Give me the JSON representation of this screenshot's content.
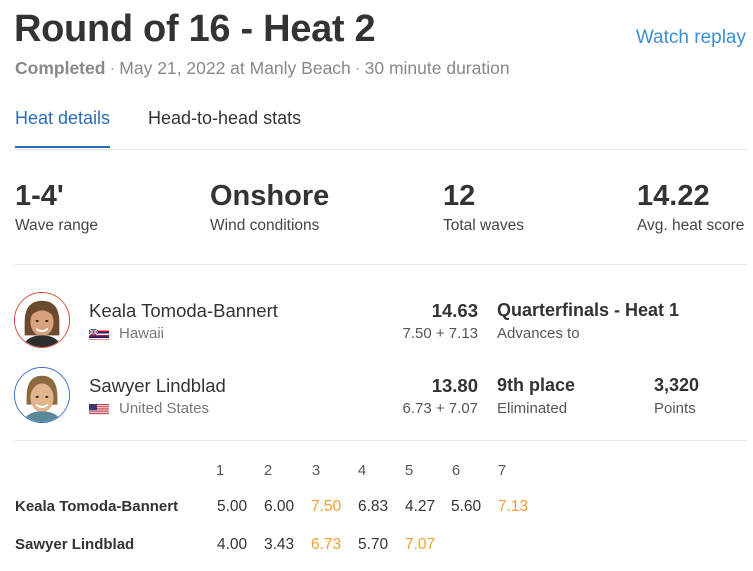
{
  "header": {
    "title": "Round of 16 - Heat 2",
    "watch_replay": "Watch replay",
    "status": "Completed",
    "date_location": "May 21, 2022 at Manly Beach",
    "duration": "30 minute duration",
    "separator": "·"
  },
  "tabs": [
    {
      "label": "Heat details",
      "active": true
    },
    {
      "label": "Head-to-head stats",
      "active": false
    }
  ],
  "stats": [
    {
      "value": "1-4'",
      "label": "Wave range"
    },
    {
      "value": "Onshore",
      "label": "Wind conditions"
    },
    {
      "value": "12",
      "label": "Total waves"
    },
    {
      "value": "14.22",
      "label": "Avg. heat score"
    }
  ],
  "surfers": [
    {
      "name": "Keala Tomoda-Bannert",
      "country": "Hawaii",
      "flag": "hawaii-flag-icon",
      "total": "14.63",
      "breakdown": "7.50 + 7.13",
      "result": "Quarterfinals - Heat 1",
      "result_label": "Advances to",
      "points": "",
      "points_label": "",
      "ring_color": "#d94a3a"
    },
    {
      "name": "Sawyer Lindblad",
      "country": "United States",
      "flag": "usa-flag-icon",
      "total": "13.80",
      "breakdown": "6.73 + 7.07",
      "result": "9th place",
      "result_label": "Eliminated",
      "points": "3,320",
      "points_label": "Points",
      "ring_color": "#3a6bc9"
    }
  ],
  "wave_grid": {
    "headers": [
      "1",
      "2",
      "3",
      "4",
      "5",
      "6",
      "7"
    ],
    "rows": [
      {
        "name": "Keala Tomoda-Bannert",
        "scores": [
          "5.00",
          "6.00",
          "7.50",
          "6.83",
          "4.27",
          "5.60",
          "7.13"
        ],
        "counted": [
          2,
          6
        ]
      },
      {
        "name": "Sawyer Lindblad",
        "scores": [
          "4.00",
          "3.43",
          "6.73",
          "5.70",
          "7.07"
        ],
        "counted": [
          2,
          4
        ]
      }
    ],
    "highlight_color": "#f0a030"
  },
  "colors": {
    "accent": "#2a6db5",
    "link": "#3b8fd6",
    "highlight": "#f0a030"
  }
}
